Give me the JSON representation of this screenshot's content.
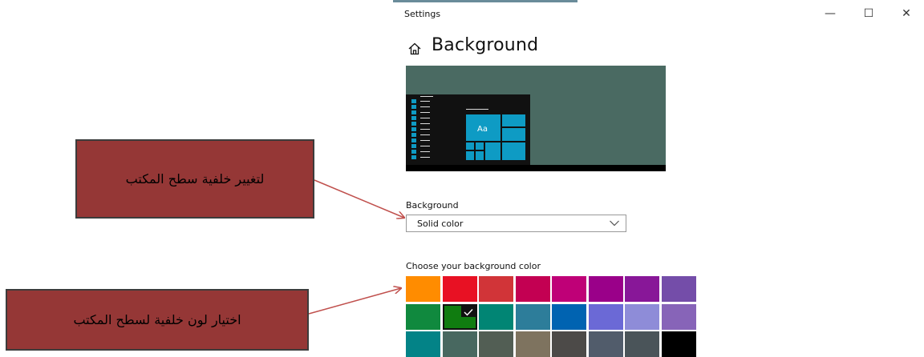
{
  "window": {
    "title": "Settings",
    "minimize": "—",
    "maximize": "☐",
    "close": "✕"
  },
  "page": {
    "title": "Background"
  },
  "preview": {
    "tile_label": "Aa"
  },
  "background_section": {
    "label": "Background",
    "value": "Solid color"
  },
  "color_section": {
    "label": "Choose your background color",
    "selected_index": 9,
    "swatches": [
      "#ff8c00",
      "#e81123",
      "#d13438",
      "#c30052",
      "#bf0077",
      "#9a0089",
      "#881798",
      "#744da9",
      "#10893e",
      "#107c10",
      "#018574",
      "#2d7d9a",
      "#0063b1",
      "#6b69d6",
      "#8e8cd8",
      "#8764b8",
      "#038387",
      "#486860",
      "#525e54",
      "#7e735f",
      "#4c4a48",
      "#515c6b",
      "#4a5459",
      "#000000"
    ]
  },
  "annotations": {
    "callout_top": "لتغيير خلفية سطح المكتب",
    "callout_bottom": "اختيار لون خلفية لسطح المكتب",
    "border_color": "#3c3c3c",
    "fill_color": "#953736",
    "arrow_color": "#c0504d"
  }
}
